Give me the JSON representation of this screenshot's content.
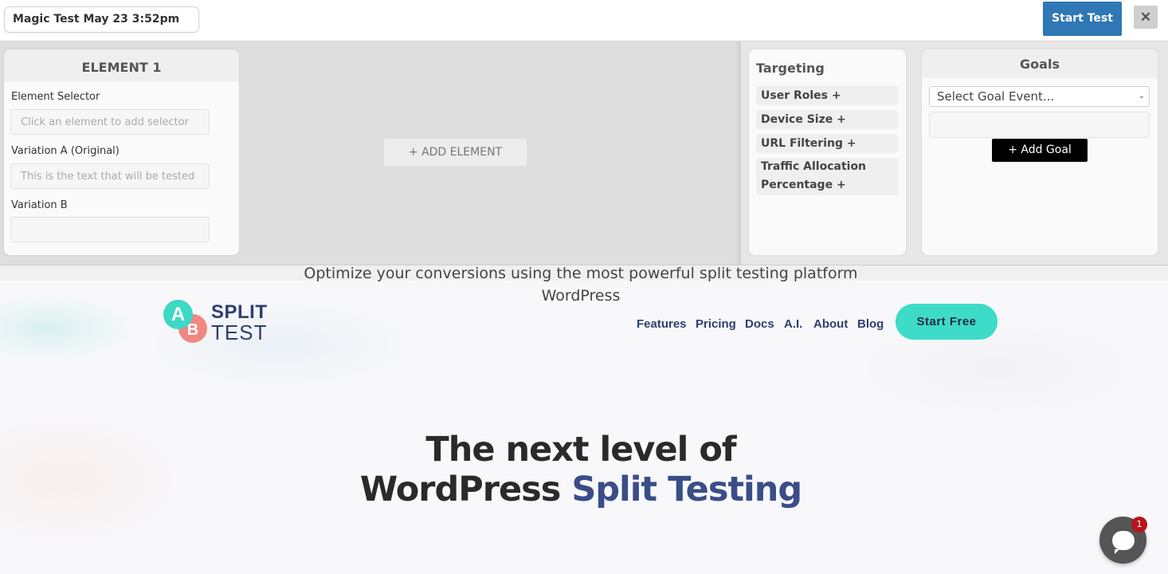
{
  "topbar": {
    "test_name": "Magic Test May 23 3:52pm",
    "start_test_label": "Start Test",
    "close_label": "✕"
  },
  "element_panel": {
    "title": "ELEMENT 1",
    "selector_label": "Element Selector",
    "selector_placeholder": "Click an element to add selector",
    "variation_a_label": "Variation A (Original)",
    "variation_a_placeholder": "This is the text that will be tested",
    "variation_b_label": "Variation B",
    "variation_b_value": ""
  },
  "add_element_label": "+ ADD ELEMENT",
  "targeting": {
    "title": "Targeting",
    "items": [
      {
        "label": "User Roles +"
      },
      {
        "label": "Device Size +"
      },
      {
        "label": "URL Filtering +"
      },
      {
        "label_line1": "Traffic Allocation",
        "label_line2": "Percentage +"
      }
    ]
  },
  "goals": {
    "title": "Goals",
    "select_value": "Select Goal Event...",
    "add_goal_label": "+ Add Goal"
  },
  "site": {
    "logo_a": "A",
    "logo_b": "B",
    "logo_split": "SPLIT",
    "logo_test": "TEST",
    "nav": [
      "Features",
      "Pricing",
      "Docs",
      "A.I.",
      "About",
      "Blog"
    ],
    "start_free_label": "Start Free",
    "hero_line1": "The next level of",
    "hero_line2_plain": "WordPress ",
    "hero_line2_accent": "Split Testing",
    "subtitle": "Optimize your conversions using the most powerful split testing platform",
    "subtitle_line2": "WordPress",
    "accent_color": "#3a4d88",
    "brand_teal": "#3ddbc8"
  },
  "chat": {
    "icon": "chat-bubble-icon",
    "badge_count": "1"
  }
}
